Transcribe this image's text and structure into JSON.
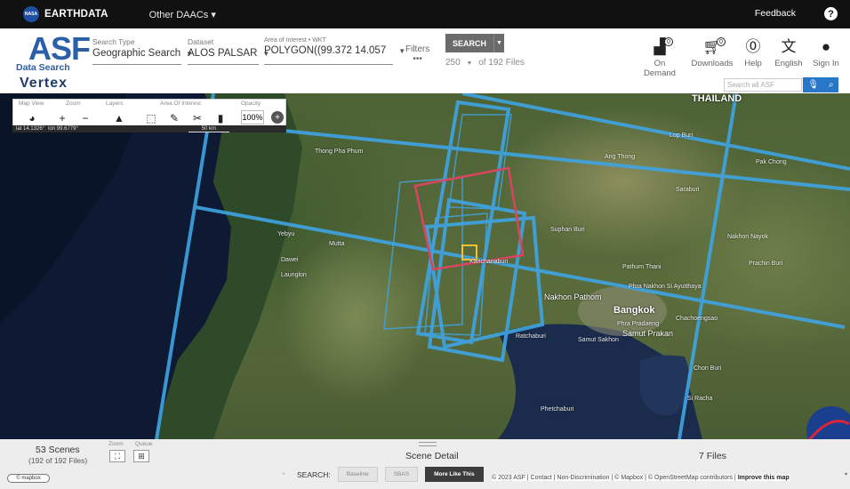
{
  "topbar": {
    "logo": "NASA",
    "brand_prefix": "EARTH",
    "brand_suffix": "DATA",
    "other_daacs": "Other DAACs ▾",
    "feedback": "Feedback",
    "help": "?"
  },
  "header": {
    "logo_main": "ASF",
    "logo_sub": "Data Search",
    "logo_product": "Vertex",
    "search_type_label": "Search Type",
    "search_type_value": "Geographic Search",
    "dataset_label": "Dataset",
    "dataset_value": "ALOS PALSAR",
    "aoi_label": "Area of Interest • WKT",
    "aoi_value": "POLYGON((99.372 14.057",
    "filters_label": "Filters",
    "filters_sub": "•••",
    "search_button": "SEARCH",
    "max_results": "250",
    "of_files": "of 192 Files",
    "on_demand": "On Demand",
    "on_demand_badge": "0",
    "downloads": "Downloads",
    "downloads_badge": "0",
    "help": "Help",
    "language": "English",
    "sign_in": "Sign In",
    "search_all_placeholder": "Search all ASF"
  },
  "map_toolbar": {
    "map_view_label": "Map View",
    "zoom_label": "Zoom",
    "layers_label": "Layers",
    "aoi_label": "Area Of Interest",
    "opacity_label": "Opacity",
    "opacity_value": "100%",
    "lat": "lat 14.1326°",
    "lon": "lon 99.6779°",
    "scale": "50 km"
  },
  "map_labels": {
    "thailand": "THAILAND",
    "bangkok": "Bangkok",
    "nakhon_pathom": "Nakhon Pathom",
    "phra_pradaeng": "Phra Pradaeng",
    "samut_prakan": "Samut Prakan",
    "samut_sakhon": "Samut Sakhon",
    "ratchaburi": "Ratchaburi",
    "phra_nakhon": "Phra Nakhon Si Ayutthaya",
    "kanchanaburi": "Kanchanaburi",
    "dawei": "Dawei",
    "thong_pha_phum": "Thong Pha Phum",
    "chachoengsao": "Chachoengsao",
    "chon_buri": "Chon Buri",
    "si_racha": "Si Racha",
    "pak_chong": "Pak Chong",
    "suphan_buri": "Suphan Buri",
    "ang_thong": "Ang Thong",
    "lop_buri": "Lop Buri",
    "saraburi": "Saraburi",
    "nakhon_nayok": "Nakhon Nayok",
    "prachin_buri": "Prachin Buri",
    "pathum_thani": "Pathum Thani",
    "mutta": "Mutta",
    "yebyu": "Yebyu",
    "launglon": "Launglon",
    "hua_hin": "Phetchaburi"
  },
  "bottom": {
    "scenes": "53 Scenes",
    "scenes_sub": "(192 of 192 Files)",
    "zoom_label": "Zoom",
    "queue_label": "Queue",
    "scene_detail": "Scene Detail",
    "files": "7 Files",
    "mapbox": "© mapbox",
    "search_label": "SEARCH:",
    "baseline": "Baseline",
    "sbas": "SBAS",
    "more_like_this": "More Like This",
    "attribution_1": "© 2023 ASF | Contact | Non-Discrimination | © Mapbox | © OpenStreetMap contributors | ",
    "attribution_2": "Improve this map"
  },
  "colors": {
    "footprint_blue": "#3fa4e3",
    "selected_red": "#d9455f",
    "aoi_yellow": "#f2c230",
    "search_blue": "#2876c8"
  }
}
